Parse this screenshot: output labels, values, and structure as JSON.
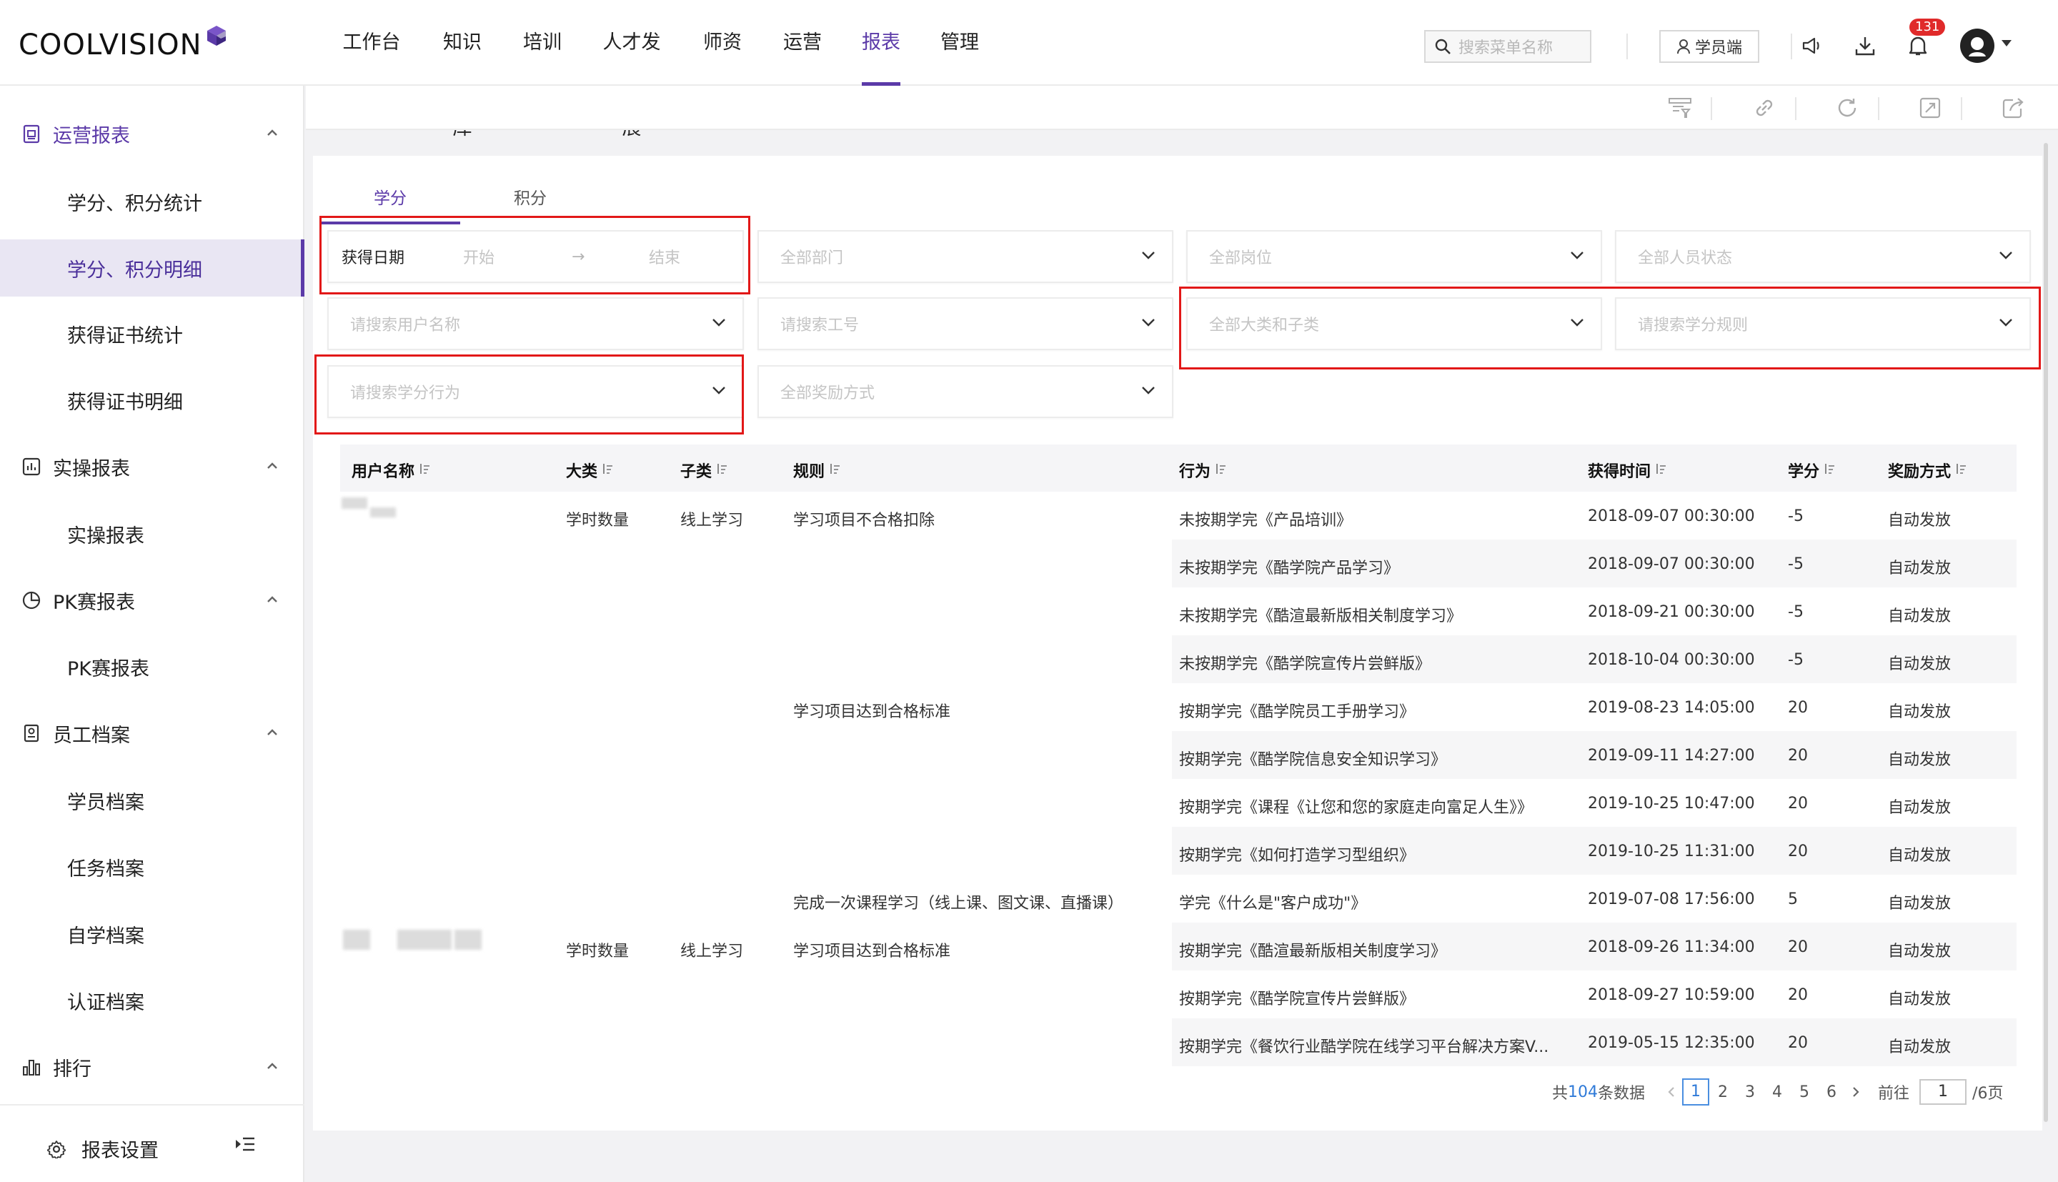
{
  "brand": {
    "logo_text": "COOLVISION"
  },
  "nav": {
    "items": [
      "工作台",
      "知识库",
      "培训",
      "人才发展",
      "师资",
      "运营",
      "报表",
      "管理"
    ],
    "active_index": 6
  },
  "header": {
    "search_placeholder": "搜索菜单名称",
    "student_button": "学员端",
    "notification_count": "131"
  },
  "sidebar": {
    "groups": [
      {
        "label": "运营报表",
        "icon": "report-icon",
        "items": [
          "学分、积分统计",
          "学分、积分明细",
          "获得证书统计",
          "获得证书明细"
        ]
      },
      {
        "label": "实操报表",
        "icon": "chart-icon",
        "items": [
          "实操报表"
        ]
      },
      {
        "label": "PK赛报表",
        "icon": "pie-icon",
        "items": [
          "PK赛报表"
        ]
      },
      {
        "label": "员工档案",
        "icon": "archive-icon",
        "items": [
          "学员档案",
          "任务档案",
          "自学档案",
          "认证档案"
        ]
      },
      {
        "label": "排行",
        "icon": "rank-icon",
        "items": []
      }
    ],
    "active_group": "运营报表",
    "active_item": "学分、积分明细",
    "settings_label": "报表设置"
  },
  "tabs": {
    "items": [
      "学分",
      "积分"
    ],
    "active_index": 0
  },
  "filters": {
    "date_label": "获得日期",
    "date_start": "开始",
    "date_arrow": "→",
    "date_end": "结束",
    "department": "全部部门",
    "position": "全部岗位",
    "status": "全部人员状态",
    "user_name": "请搜索用户名称",
    "employee_id": "请搜索工号",
    "category": "全部大类和子类",
    "rule": "请搜索学分规则",
    "behavior": "请搜索学分行为",
    "reward_method": "全部奖励方式"
  },
  "table": {
    "columns": [
      "用户名称",
      "大类",
      "子类",
      "规则",
      "行为",
      "获得时间",
      "学分",
      "奖励方式"
    ],
    "rows": [
      {
        "user": "",
        "category": "学时数量",
        "subcategory": "线上学习",
        "rule": "学习项目不合格扣除",
        "behavior": "未按期学完《产品培训》",
        "time": "2018-09-07 00:30:00",
        "credit": "-5",
        "reward": "自动发放"
      },
      {
        "user": "",
        "category": "",
        "subcategory": "",
        "rule": "",
        "behavior": "未按期学完《酷学院产品学习》",
        "time": "2018-09-07 00:30:00",
        "credit": "-5",
        "reward": "自动发放"
      },
      {
        "user": "",
        "category": "",
        "subcategory": "",
        "rule": "",
        "behavior": "未按期学完《酷渲最新版相关制度学习》",
        "time": "2018-09-21 00:30:00",
        "credit": "-5",
        "reward": "自动发放"
      },
      {
        "user": "",
        "category": "",
        "subcategory": "",
        "rule": "",
        "behavior": "未按期学完《酷学院宣传片尝鲜版》",
        "time": "2018-10-04 00:30:00",
        "credit": "-5",
        "reward": "自动发放"
      },
      {
        "user": "",
        "category": "",
        "subcategory": "",
        "rule": "学习项目达到合格标准",
        "behavior": "按期学完《酷学院员工手册学习》",
        "time": "2019-08-23 14:05:00",
        "credit": "20",
        "reward": "自动发放"
      },
      {
        "user": "",
        "category": "",
        "subcategory": "",
        "rule": "",
        "behavior": "按期学完《酷学院信息安全知识学习》",
        "time": "2019-09-11 14:27:00",
        "credit": "20",
        "reward": "自动发放"
      },
      {
        "user": "",
        "category": "",
        "subcategory": "",
        "rule": "",
        "behavior": "按期学完《课程《让您和您的家庭走向富足人生》》",
        "time": "2019-10-25 10:47:00",
        "credit": "20",
        "reward": "自动发放"
      },
      {
        "user": "",
        "category": "",
        "subcategory": "",
        "rule": "",
        "behavior": "按期学完《如何打造学习型组织》",
        "time": "2019-10-25 11:31:00",
        "credit": "20",
        "reward": "自动发放"
      },
      {
        "user": "",
        "category": "",
        "subcategory": "",
        "rule": "完成一次课程学习（线上课、图文课、直播课）",
        "behavior": "学完《什么是\"客户成功\"》",
        "time": "2019-07-08 17:56:00",
        "credit": "5",
        "reward": "自动发放"
      },
      {
        "user": "",
        "category": "学时数量",
        "subcategory": "线上学习",
        "rule": "学习项目达到合格标准",
        "behavior": "按期学完《酷渲最新版相关制度学习》",
        "time": "2018-09-26 11:34:00",
        "credit": "20",
        "reward": "自动发放"
      },
      {
        "user": "",
        "category": "",
        "subcategory": "",
        "rule": "",
        "behavior": "按期学完《酷学院宣传片尝鲜版》",
        "time": "2018-09-27 10:59:00",
        "credit": "20",
        "reward": "自动发放"
      },
      {
        "user": "",
        "category": "",
        "subcategory": "",
        "rule": "",
        "behavior": "按期学完《餐饮行业酷学院在线学习平台解决方案V...",
        "time": "2019-05-15 12:35:00",
        "credit": "20",
        "reward": "自动发放"
      }
    ]
  },
  "pagination": {
    "total_prefix": "共",
    "total": "104",
    "total_suffix": "条数据",
    "pages": [
      "1",
      "2",
      "3",
      "4",
      "5",
      "6"
    ],
    "current": "1",
    "goto_label": "前往",
    "goto_value": "1",
    "page_suffix": "/6页"
  },
  "colors": {
    "accent": "#5b3aa8",
    "highlight": "#e21818",
    "link": "#2f7ad8",
    "badge": "#e02a2a"
  }
}
